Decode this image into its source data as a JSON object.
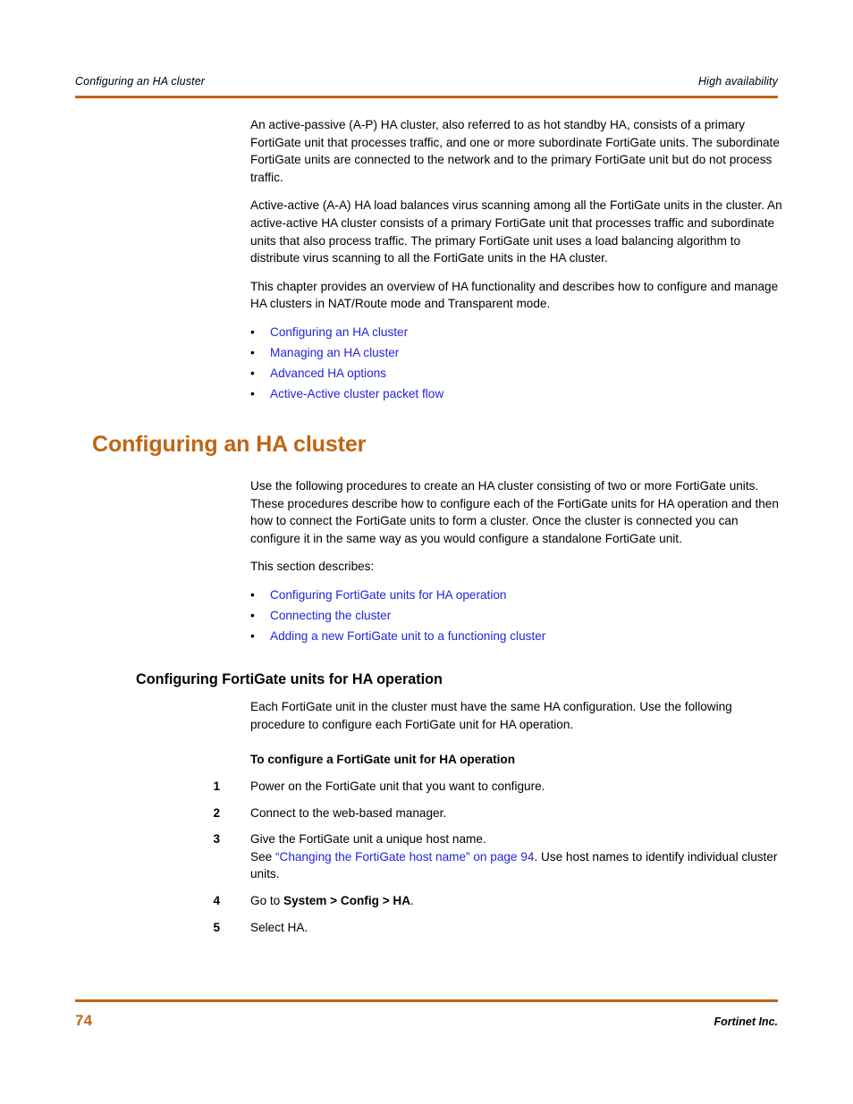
{
  "header": {
    "left": "Configuring an HA cluster",
    "right": "High availability"
  },
  "footer": {
    "page_number": "74",
    "company": "Fortinet Inc."
  },
  "colors": {
    "accent": "#BF6512",
    "link": "#2424D8",
    "text": "#000000"
  },
  "intro": {
    "paragraph_1": "An active-passive (A-P) HA cluster, also referred to as hot standby HA, consists of a primary FortiGate unit that processes traffic, and one or more subordinate FortiGate units. The subordinate FortiGate units are connected to the network and to the primary FortiGate unit but do not process traffic.",
    "paragraph_2": "Active-active (A-A) HA load balances virus scanning among all the FortiGate units in the cluster. An active-active HA cluster consists of a primary FortiGate unit that processes traffic and subordinate units that also process traffic. The primary FortiGate unit uses a load balancing algorithm to distribute virus scanning to all the FortiGate units in the HA cluster.",
    "paragraph_3": "This chapter provides an overview of HA functionality and describes how to configure and manage HA clusters in NAT/Route mode and Transparent mode.",
    "bullet_marker": "•",
    "links": [
      "Configuring an HA cluster",
      "Managing an HA cluster",
      "Advanced HA options",
      "Active-Active cluster packet flow"
    ]
  },
  "chapter_heading": "Configuring an HA cluster",
  "section_intro": {
    "paragraph_1": "Use the following procedures to create an HA cluster consisting of two or more FortiGate units. These procedures describe how to configure each of the FortiGate units for HA operation and then how to connect the FortiGate units to form a cluster. Once the cluster is connected you can configure it in the same way as you would configure a standalone FortiGate unit.",
    "paragraph_2": "This section describes:",
    "links": [
      "Configuring FortiGate units for HA operation",
      "Connecting the cluster",
      "Adding a new FortiGate unit to a functioning cluster"
    ]
  },
  "subsection": {
    "heading": "Configuring FortiGate units for HA operation",
    "paragraph": "Each FortiGate unit in the cluster must have the same HA configuration. Use the following procedure to configure each FortiGate unit for HA operation.",
    "procedure_title": "To configure a FortiGate unit for HA operation",
    "steps": [
      {
        "number": "1",
        "text": "Power on the FortiGate unit that you want to configure."
      },
      {
        "number": "2",
        "text": "Connect to the web-based manager."
      },
      {
        "number": "3",
        "text": "Give the FortiGate unit a unique host name.",
        "note_before": "See ",
        "note_link": "“Changing the FortiGate host name” on page 94",
        "note_after": ". Use host names to identify individual cluster units."
      },
      {
        "number": "4",
        "text_before": "Go to ",
        "text_bold": "System > Config > HA",
        "text_after": "."
      },
      {
        "number": "5",
        "text": "Select HA."
      }
    ]
  }
}
